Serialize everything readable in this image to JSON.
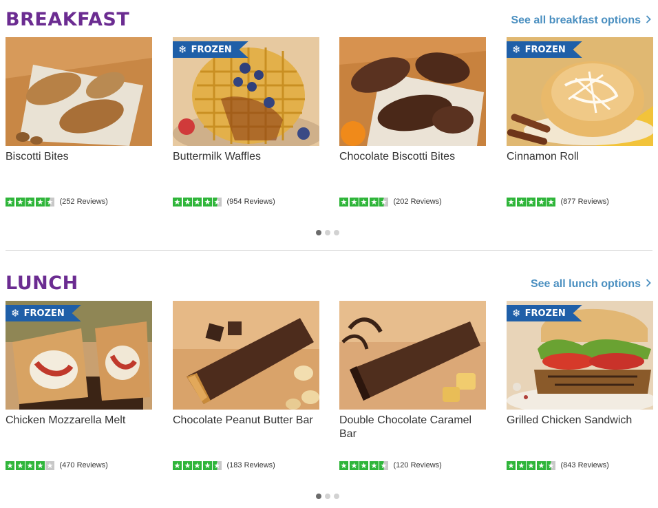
{
  "colors": {
    "purple": "#6b2c91",
    "link_blue": "#4a8fc0",
    "star_green": "#2fb53a",
    "frozen_blue": "#1f5fa8",
    "dot_active": "#6b6b6b",
    "dot_inactive": "#d2d2d2"
  },
  "breakfast": {
    "title": "BREAKFAST",
    "see_all": "See all breakfast options",
    "items": [
      {
        "name": "Biscotti Bites",
        "reviews": "(252 Reviews)",
        "rating": 4.5,
        "frozen": false
      },
      {
        "name": "Buttermilk Waffles",
        "reviews": "(954 Reviews)",
        "rating": 4.5,
        "frozen": true,
        "badge": "FROZEN"
      },
      {
        "name": "Chocolate Biscotti Bites",
        "reviews": "(202 Reviews)",
        "rating": 4.5,
        "frozen": false
      },
      {
        "name": "Cinnamon Roll",
        "reviews": "(877 Reviews)",
        "rating": 5,
        "frozen": true,
        "badge": "FROZEN"
      }
    ],
    "carousel": {
      "pages": 3,
      "active": 1
    }
  },
  "lunch": {
    "title": "LUNCH",
    "see_all": "See all lunch options",
    "items": [
      {
        "name": "Chicken Mozzarella Melt",
        "reviews": "(470 Reviews)",
        "rating": 4,
        "frozen": true,
        "badge": "FROZEN"
      },
      {
        "name": "Chocolate Peanut Butter Bar",
        "reviews": "(183 Reviews)",
        "rating": 4.5,
        "frozen": false
      },
      {
        "name": "Double Chocolate Caramel Bar",
        "reviews": "(120 Reviews)",
        "rating": 4.5,
        "frozen": false
      },
      {
        "name": "Grilled Chicken Sandwich",
        "reviews": "(843 Reviews)",
        "rating": 4.5,
        "frozen": true,
        "badge": "FROZEN"
      }
    ],
    "carousel": {
      "pages": 3,
      "active": 1
    }
  }
}
